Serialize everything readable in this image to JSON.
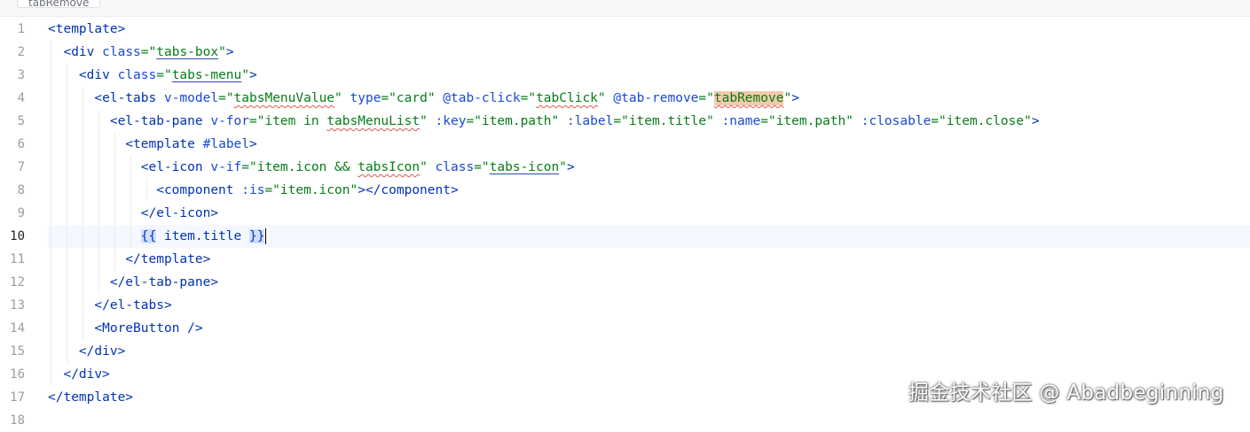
{
  "breadcrumb": {
    "label": "tabRemove"
  },
  "gutter": {
    "lines": [
      "1",
      "2",
      "3",
      "4",
      "5",
      "6",
      "7",
      "8",
      "9",
      "10",
      "11",
      "12",
      "13",
      "14",
      "15",
      "16",
      "17",
      "18"
    ],
    "current": "10"
  },
  "code": {
    "l1": {
      "p1": "<template>"
    },
    "l2": {
      "p1": "<div ",
      "p2": "class",
      "p3": "=\"",
      "p4": "tabs-box",
      "p5": "\"",
      "p6": ">"
    },
    "l3": {
      "p1": "<div ",
      "p2": "class",
      "p3": "=\"",
      "p4": "tabs-menu",
      "p5": "\"",
      "p6": ">"
    },
    "l4": {
      "p1": "<el-tabs ",
      "p2": "v-model",
      "p3": "=\"",
      "p4": "tabsMenuValue",
      "p5": "\" ",
      "p6": "type",
      "p7": "=\"card\" ",
      "p8": "@tab-click",
      "p9": "=\"",
      "p10": "tabClick",
      "p11": "\" ",
      "p12": "@tab-remove",
      "p13": "=\"",
      "p14": "tabRemove",
      "p15": "\"",
      "p16": ">"
    },
    "l5": {
      "p1": "<el-tab-pane ",
      "p2": "v-for",
      "p3": "=\"item in ",
      "p4": "tabsMenuList",
      "p5": "\" ",
      "p6": ":key",
      "p7": "=\"item.path\" ",
      "p8": ":label",
      "p9": "=\"item.title\" ",
      "p10": ":name",
      "p11": "=\"item.path\" ",
      "p12": ":closable",
      "p13": "=\"item.close\"",
      "p14": ">"
    },
    "l6": {
      "p1": "<template ",
      "p2": "#label",
      "p3": ">"
    },
    "l7": {
      "p1": "<el-icon ",
      "p2": "v-if",
      "p3": "=\"item.icon && ",
      "p4": "tabsIcon",
      "p5": "\" ",
      "p6": "class",
      "p7": "=\"",
      "p8": "tabs-icon",
      "p9": "\"",
      "p10": ">"
    },
    "l8": {
      "p1": "<component ",
      "p2": ":is",
      "p3": "=\"item.icon\"",
      "p4": "></component>"
    },
    "l9": {
      "p1": "</el-icon>"
    },
    "l10": {
      "p1": "{{",
      "p2": " item.title ",
      "p3": "}}"
    },
    "l11": {
      "p1": "</template>"
    },
    "l12": {
      "p1": "</el-tab-pane>"
    },
    "l13": {
      "p1": "</el-tabs>"
    },
    "l14": {
      "p1": "<MoreButton />"
    },
    "l15": {
      "p1": "</div>"
    },
    "l16": {
      "p1": "</div>"
    },
    "l17": {
      "p1": "</template>"
    }
  },
  "watermark": {
    "text": "掘金技术社区 @ Abadbeginning"
  },
  "colors": {
    "tag": "#0033b3",
    "attribute": "#174ad4",
    "string": "#067d17",
    "text": "#080808",
    "line_number": "#9b9da3",
    "current_line_bg": "#f5f8fe",
    "highlight": "#f3c9ab",
    "brace_match": "#d3deff",
    "typo_underline": "#e05555"
  },
  "icons": {
    "breadcrumb_chevron": "chevron-up-icon"
  }
}
